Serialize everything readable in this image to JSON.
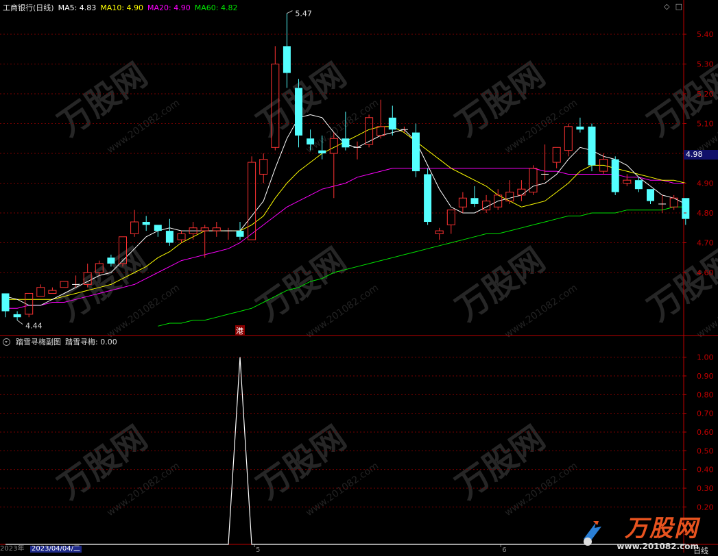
{
  "header": {
    "title": "工商银行(日线)",
    "ma5_label": "MA5: 4.83",
    "ma10_label": "MA10: 4.90",
    "ma20_label": "MA20: 4.90",
    "ma60_label": "MA60: 4.82",
    "icons": [
      "diamond-icon",
      "window-icon"
    ]
  },
  "colors": {
    "up": "#ff3232",
    "down": "#54ffff",
    "ma5": "#ffffff",
    "ma10": "#ffff00",
    "ma20": "#ff00ff",
    "ma60": "#00e600",
    "grid": "#7a0000",
    "axis": "#c00000",
    "indicator": "#ffffff"
  },
  "price_axis": {
    "ticks": [
      "5.40",
      "5.30",
      "5.20",
      "5.10",
      "5.00",
      "4.90",
      "4.80",
      "4.70",
      "4.60"
    ],
    "current_price": "4.98"
  },
  "annotations": {
    "high_label": "5.47",
    "low_label": "4.44",
    "hk_flag": "港"
  },
  "sub_panel": {
    "title": "踏雪寻梅副图",
    "value_label": "踏雪寻梅: 0.00",
    "ticks": [
      "1.00",
      "0.90",
      "0.80",
      "0.70",
      "0.60",
      "0.50",
      "0.40",
      "0.30",
      "0.20"
    ]
  },
  "footer": {
    "year_label": "2023年",
    "cursor_date": "2023/04/04/二",
    "month_ticks": [
      "5",
      "6"
    ],
    "period": "日线"
  },
  "watermark": {
    "brand": "万股网",
    "site": "www.201082.com"
  },
  "chart_data": {
    "type": "candlestick",
    "ylim": [
      4.39,
      5.5
    ],
    "candles": [
      {
        "o": 4.53,
        "c": 4.47,
        "h": 4.53,
        "l": 4.45
      },
      {
        "o": 4.46,
        "c": 4.45,
        "h": 4.47,
        "l": 4.44
      },
      {
        "o": 4.46,
        "c": 4.53,
        "h": 4.53,
        "l": 4.45
      },
      {
        "o": 4.52,
        "c": 4.55,
        "h": 4.56,
        "l": 4.52
      },
      {
        "o": 4.53,
        "c": 4.54,
        "h": 4.55,
        "l": 4.53
      },
      {
        "o": 4.55,
        "c": 4.57,
        "h": 4.57,
        "l": 4.55
      },
      {
        "o": 4.56,
        "c": 4.56,
        "h": 4.59,
        "l": 4.55
      },
      {
        "o": 4.56,
        "c": 4.6,
        "h": 4.63,
        "l": 4.55
      },
      {
        "o": 4.6,
        "c": 4.63,
        "h": 4.64,
        "l": 4.59
      },
      {
        "o": 4.65,
        "c": 4.63,
        "h": 4.66,
        "l": 4.62
      },
      {
        "o": 4.63,
        "c": 4.72,
        "h": 4.72,
        "l": 4.62
      },
      {
        "o": 4.73,
        "c": 4.77,
        "h": 4.81,
        "l": 4.72
      },
      {
        "o": 4.77,
        "c": 4.76,
        "h": 4.79,
        "l": 4.74
      },
      {
        "o": 4.76,
        "c": 4.74,
        "h": 4.76,
        "l": 4.72
      },
      {
        "o": 4.74,
        "c": 4.7,
        "h": 4.78,
        "l": 4.69
      },
      {
        "o": 4.71,
        "c": 4.73,
        "h": 4.74,
        "l": 4.7
      },
      {
        "o": 4.73,
        "c": 4.75,
        "h": 4.77,
        "l": 4.71
      },
      {
        "o": 4.74,
        "c": 4.75,
        "h": 4.76,
        "l": 4.65
      },
      {
        "o": 4.74,
        "c": 4.75,
        "h": 4.77,
        "l": 4.72
      },
      {
        "o": 4.74,
        "c": 4.74,
        "h": 4.75,
        "l": 4.71
      },
      {
        "o": 4.74,
        "c": 4.72,
        "h": 4.77,
        "l": 4.71
      },
      {
        "o": 4.71,
        "c": 4.97,
        "h": 4.99,
        "l": 4.71
      },
      {
        "o": 4.93,
        "c": 4.98,
        "h": 5.0,
        "l": 4.9
      },
      {
        "o": 5.02,
        "c": 5.3,
        "h": 5.36,
        "l": 5.01
      },
      {
        "o": 5.36,
        "c": 5.27,
        "h": 5.47,
        "l": 5.22
      },
      {
        "o": 5.22,
        "c": 5.06,
        "h": 5.25,
        "l": 5.02
      },
      {
        "o": 5.05,
        "c": 5.03,
        "h": 5.08,
        "l": 5.01
      },
      {
        "o": 5.01,
        "c": 5.0,
        "h": 5.06,
        "l": 4.98
      },
      {
        "o": 5.0,
        "c": 5.05,
        "h": 5.07,
        "l": 4.85
      },
      {
        "o": 5.05,
        "c": 5.02,
        "h": 5.14,
        "l": 5.01
      },
      {
        "o": 5.02,
        "c": 5.02,
        "h": 5.04,
        "l": 4.98
      },
      {
        "o": 5.03,
        "c": 5.12,
        "h": 5.13,
        "l": 5.02
      },
      {
        "o": 5.06,
        "c": 5.09,
        "h": 5.18,
        "l": 5.05
      },
      {
        "o": 5.12,
        "c": 5.08,
        "h": 5.16,
        "l": 5.06
      },
      {
        "o": 5.08,
        "c": 5.08,
        "h": 5.09,
        "l": 5.07
      },
      {
        "o": 5.07,
        "c": 4.94,
        "h": 5.1,
        "l": 4.92
      },
      {
        "o": 4.93,
        "c": 4.77,
        "h": 4.95,
        "l": 4.76
      },
      {
        "o": 4.73,
        "c": 4.74,
        "h": 4.75,
        "l": 4.71
      },
      {
        "o": 4.76,
        "c": 4.81,
        "h": 4.81,
        "l": 4.73
      },
      {
        "o": 4.82,
        "c": 4.85,
        "h": 4.87,
        "l": 4.8
      },
      {
        "o": 4.85,
        "c": 4.83,
        "h": 4.89,
        "l": 4.82
      },
      {
        "o": 4.81,
        "c": 4.84,
        "h": 4.86,
        "l": 4.8
      },
      {
        "o": 4.82,
        "c": 4.86,
        "h": 4.88,
        "l": 4.81
      },
      {
        "o": 4.84,
        "c": 4.87,
        "h": 4.91,
        "l": 4.83
      },
      {
        "o": 4.86,
        "c": 4.88,
        "h": 4.91,
        "l": 4.84
      },
      {
        "o": 4.87,
        "c": 4.95,
        "h": 4.96,
        "l": 4.86
      },
      {
        "o": 4.93,
        "c": 4.93,
        "h": 5.03,
        "l": 4.91
      },
      {
        "o": 4.97,
        "c": 5.02,
        "h": 5.02,
        "l": 4.95
      },
      {
        "o": 5.01,
        "c": 5.09,
        "h": 5.1,
        "l": 4.99
      },
      {
        "o": 5.09,
        "c": 5.08,
        "h": 5.12,
        "l": 5.07
      },
      {
        "o": 5.09,
        "c": 4.96,
        "h": 5.1,
        "l": 4.94
      },
      {
        "o": 4.94,
        "c": 4.98,
        "h": 5.0,
        "l": 4.93
      },
      {
        "o": 4.98,
        "c": 4.87,
        "h": 4.99,
        "l": 4.86
      },
      {
        "o": 4.9,
        "c": 4.91,
        "h": 4.93,
        "l": 4.89
      },
      {
        "o": 4.91,
        "c": 4.88,
        "h": 4.92,
        "l": 4.87
      },
      {
        "o": 4.88,
        "c": 4.84,
        "h": 4.88,
        "l": 4.83
      },
      {
        "o": 4.83,
        "c": 4.83,
        "h": 4.86,
        "l": 4.8
      },
      {
        "o": 4.82,
        "c": 4.85,
        "h": 4.86,
        "l": 4.81
      },
      {
        "o": 4.85,
        "c": 4.78,
        "h": 4.85,
        "l": 4.76
      }
    ],
    "ma5": [
      4.52,
      4.51,
      4.49,
      4.49,
      4.51,
      4.53,
      4.55,
      4.57,
      4.59,
      4.6,
      4.64,
      4.68,
      4.72,
      4.74,
      4.75,
      4.74,
      4.74,
      4.74,
      4.74,
      4.74,
      4.74,
      4.79,
      4.84,
      4.95,
      5.05,
      5.12,
      5.13,
      5.12,
      5.07,
      5.03,
      5.02,
      5.04,
      5.06,
      5.07,
      5.08,
      5.04,
      4.96,
      4.88,
      4.82,
      4.8,
      4.8,
      4.82,
      4.84,
      4.85,
      4.86,
      4.89,
      4.9,
      4.93,
      4.98,
      5.02,
      5.01,
      4.99,
      4.98,
      4.96,
      4.92,
      4.89,
      4.86,
      4.85,
      4.83
    ],
    "ma10": [
      4.51,
      4.51,
      4.51,
      4.51,
      4.51,
      4.52,
      4.53,
      4.54,
      4.55,
      4.56,
      4.58,
      4.6,
      4.62,
      4.65,
      4.67,
      4.7,
      4.72,
      4.74,
      4.74,
      4.74,
      4.74,
      4.76,
      4.79,
      4.85,
      4.9,
      4.94,
      4.97,
      5.0,
      5.02,
      5.04,
      5.06,
      5.08,
      5.09,
      5.09,
      5.07,
      5.04,
      5.01,
      4.98,
      4.95,
      4.93,
      4.91,
      4.89,
      4.86,
      4.84,
      4.82,
      4.83,
      4.84,
      4.87,
      4.9,
      4.94,
      4.96,
      4.96,
      4.95,
      4.94,
      4.93,
      4.92,
      4.91,
      4.91,
      4.9
    ],
    "ma20": [
      4.48,
      4.48,
      4.49,
      4.49,
      4.5,
      4.5,
      4.51,
      4.52,
      4.53,
      4.54,
      4.55,
      4.56,
      4.58,
      4.6,
      4.62,
      4.64,
      4.65,
      4.66,
      4.67,
      4.68,
      4.7,
      4.73,
      4.76,
      4.79,
      4.82,
      4.84,
      4.86,
      4.88,
      4.89,
      4.9,
      4.92,
      4.93,
      4.94,
      4.95,
      4.95,
      4.95,
      4.95,
      4.95,
      4.95,
      4.95,
      4.95,
      4.95,
      4.95,
      4.95,
      4.95,
      4.95,
      4.94,
      4.94,
      4.93,
      4.93,
      4.93,
      4.93,
      4.93,
      4.92,
      4.92,
      4.91,
      4.91,
      4.9,
      4.9
    ],
    "ma60_start_index": 13,
    "ma60": [
      4.42,
      4.43,
      4.43,
      4.44,
      4.44,
      4.45,
      4.46,
      4.47,
      4.48,
      4.5,
      4.52,
      4.54,
      4.55,
      4.57,
      4.58,
      4.6,
      4.61,
      4.62,
      4.63,
      4.64,
      4.65,
      4.66,
      4.67,
      4.68,
      4.69,
      4.7,
      4.71,
      4.72,
      4.73,
      4.73,
      4.74,
      4.75,
      4.76,
      4.77,
      4.78,
      4.79,
      4.79,
      4.8,
      4.8,
      4.8,
      4.81,
      4.81,
      4.81,
      4.81,
      4.82,
      4.82
    ],
    "indicator": {
      "name": "踏雪寻梅",
      "ylim": [
        0,
        1.05
      ],
      "values": [
        0,
        0,
        0,
        0,
        0,
        0,
        0,
        0,
        0,
        0,
        0,
        0,
        0,
        0,
        0,
        0,
        0,
        0,
        0,
        0,
        1,
        0,
        0,
        0,
        0,
        0,
        0,
        0,
        0,
        0,
        0,
        0,
        0,
        0,
        0,
        0,
        0,
        0,
        0,
        0,
        0,
        0,
        0,
        0,
        0,
        0,
        0,
        0,
        0,
        0,
        0,
        0,
        0,
        0,
        0,
        0,
        0,
        0,
        0
      ]
    }
  }
}
